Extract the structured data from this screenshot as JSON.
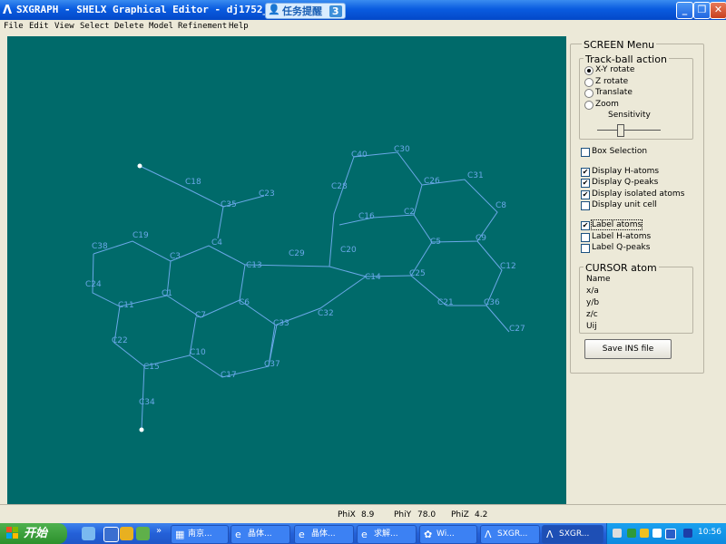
{
  "window": {
    "app_glyph": "Λ",
    "title": "SXGRAPH - SHELX Graphical Editor - dj1752_0m",
    "task_badge": {
      "icon": "👤",
      "label": "任务提醒",
      "count": "3"
    },
    "minimize": "_",
    "maximize": "❐",
    "close": "✕"
  },
  "menu": [
    "File",
    "Edit",
    "View",
    "Select",
    "Delete",
    "Model",
    "Refinement",
    "Help"
  ],
  "molecule": {
    "atoms": [
      {
        "label": "C18"
      },
      {
        "label": "C35"
      },
      {
        "label": "C23"
      },
      {
        "label": "C40"
      },
      {
        "label": "C30"
      },
      {
        "label": "C28"
      },
      {
        "label": "C26"
      },
      {
        "label": "C31"
      },
      {
        "label": "C8"
      },
      {
        "label": "C16"
      },
      {
        "label": "C2"
      },
      {
        "label": "C5"
      },
      {
        "label": "C9"
      },
      {
        "label": "C19"
      },
      {
        "label": "C4"
      },
      {
        "label": "C38"
      },
      {
        "label": "C3"
      },
      {
        "label": "C13"
      },
      {
        "label": "C29"
      },
      {
        "label": "C20"
      },
      {
        "label": "C12"
      },
      {
        "label": "C24"
      },
      {
        "label": "C1"
      },
      {
        "label": "C14"
      },
      {
        "label": "C25"
      },
      {
        "label": "C11"
      },
      {
        "label": "C6"
      },
      {
        "label": "C21"
      },
      {
        "label": "C36"
      },
      {
        "label": "C7"
      },
      {
        "label": "C32"
      },
      {
        "label": "C33"
      },
      {
        "label": "C22"
      },
      {
        "label": "C27"
      },
      {
        "label": "C10"
      },
      {
        "label": "C15"
      },
      {
        "label": "C37"
      },
      {
        "label": "C17"
      },
      {
        "label": "C34"
      }
    ]
  },
  "panel": {
    "screen_menu": "SCREEN Menu",
    "trackball": {
      "title": "Track-ball action",
      "options": [
        "X-Y rotate",
        "Z rotate",
        "Translate",
        "Zoom"
      ],
      "selected": 0,
      "sensitivity_label": "Sensitivity",
      "sensitivity_level": 0.35
    },
    "checks_a": [
      {
        "label": "Box Selection",
        "checked": false
      }
    ],
    "checks_b": [
      {
        "label": "Display H-atoms",
        "checked": true
      },
      {
        "label": "Display Q-peaks",
        "checked": true
      },
      {
        "label": "Display isolated atoms",
        "checked": true
      },
      {
        "label": "Display unit cell",
        "checked": false
      }
    ],
    "checks_c": [
      {
        "label": "Label atoms",
        "checked": true
      },
      {
        "label": "Label H-atoms",
        "checked": false
      },
      {
        "label": "Label Q-peaks",
        "checked": false
      }
    ],
    "cursor": {
      "title": "CURSOR atom",
      "fields": [
        "Name",
        "x/a",
        "y/b",
        "z/c",
        "Uij"
      ]
    },
    "save_button": "Save INS file"
  },
  "status": {
    "phix_label": "PhiX",
    "phix": "8.9",
    "phiy_label": "PhiY",
    "phiy": "78.0",
    "phiz_label": "PhiZ",
    "phiz": "4.2"
  },
  "taskbar": {
    "start": "开始",
    "more": "»",
    "tasks": [
      {
        "icon": "▦",
        "label": "南京..."
      },
      {
        "icon": "e",
        "label": "晶体..."
      },
      {
        "icon": "e",
        "label": "晶体..."
      },
      {
        "icon": "e",
        "label": "求解..."
      },
      {
        "icon": "✿",
        "label": "Wi..."
      },
      {
        "icon": "Λ",
        "label": "SXGR..."
      },
      {
        "icon": "Λ",
        "label": "SXGR..."
      }
    ],
    "active_task": 6,
    "clock": "10:56"
  },
  "colors": {
    "canvas": "#006a6a",
    "bond": "#6aa8e8",
    "titlebar": "#0a5ce0",
    "taskbar": "#2460d8"
  }
}
